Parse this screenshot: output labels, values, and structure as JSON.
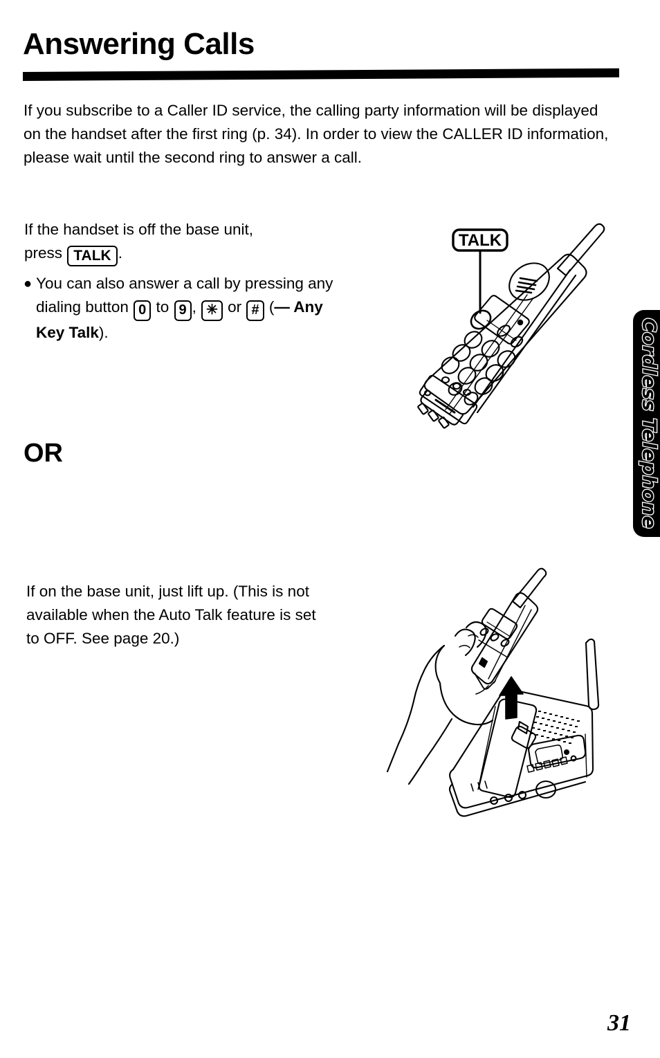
{
  "page": {
    "title": "Answering Calls",
    "number": "31",
    "side_tab_label": "Cordless Telephone"
  },
  "intro": {
    "paragraph": "If you subscribe to a Caller ID service, the calling party information will be displayed on the handset after the first ring (p. 34). In order to view the CALLER ID information, please wait until the second ring to answer a call."
  },
  "section_handset_off": {
    "instruction_line1": "If the handset is off the base unit,",
    "instruction_line2_prefix": "press ",
    "talk_key": "TALK",
    "instruction_line2_suffix": ".",
    "bullet": {
      "part1": "You can also answer a call by pressing any dialing button ",
      "key_zero": "0",
      "part2": " to ",
      "key_nine": "9",
      "part3": ", ",
      "key_star": "✳",
      "part4": " or ",
      "key_hash": "#",
      "part5": " (",
      "emdash_note": "— Any Key Talk",
      "part6": ")."
    }
  },
  "divider": {
    "or_label": "OR"
  },
  "section_base_unit": {
    "instruction": "If on the base unit, just lift up. (This is not available when the Auto Talk feature is set to OFF. See page 20.)"
  },
  "figures": {
    "handset": {
      "name": "cordless-handset-with-talk-callout",
      "callout_label": "TALK",
      "description": "Line drawing of a cordless handset held at an angle with a leader line from the TALK label box to the TALK button."
    },
    "base": {
      "name": "hand-lifting-handset-from-base",
      "description": "Line drawing of a hand lifting the cordless handset up off the base unit, with an upward arrow."
    }
  },
  "colors": {
    "ink": "#000000",
    "paper": "#ffffff"
  }
}
